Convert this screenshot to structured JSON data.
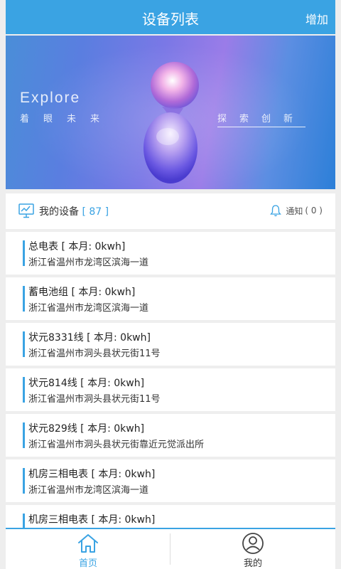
{
  "header": {
    "title": "设备列表",
    "add_label": "增加"
  },
  "banner": {
    "explore": "Explore",
    "left_sub": "着眼未来",
    "right_sub": "探索创新"
  },
  "summary": {
    "label": "我的设备",
    "count_text": "[ 87 ]",
    "notice_label": "通知",
    "notice_count": "( 0 )"
  },
  "devices": [
    {
      "name": "总电表 [ 本月: 0kwh]",
      "address": "浙江省温州市龙湾区滨海一道"
    },
    {
      "name": "蓄电池组 [ 本月: 0kwh]",
      "address": "浙江省温州市龙湾区滨海一道"
    },
    {
      "name": "状元8331线 [ 本月: 0kwh]",
      "address": "浙江省温州市洞头县状元街11号"
    },
    {
      "name": "状元814线 [ 本月: 0kwh]",
      "address": "浙江省温州市洞头县状元街11号"
    },
    {
      "name": "状元829线 [ 本月: 0kwh]",
      "address": "浙江省温州市洞头县状元街靠近元觉派出所"
    },
    {
      "name": "机房三相电表 [ 本月: 0kwh]",
      "address": "浙江省温州市龙湾区滨海一道"
    },
    {
      "name": "机房三相电表 [ 本月: 0kwh]",
      "address": ""
    }
  ],
  "tabs": {
    "home_label": "首页",
    "mine_label": "我的"
  },
  "colors": {
    "accent": "#3aa3e3"
  }
}
